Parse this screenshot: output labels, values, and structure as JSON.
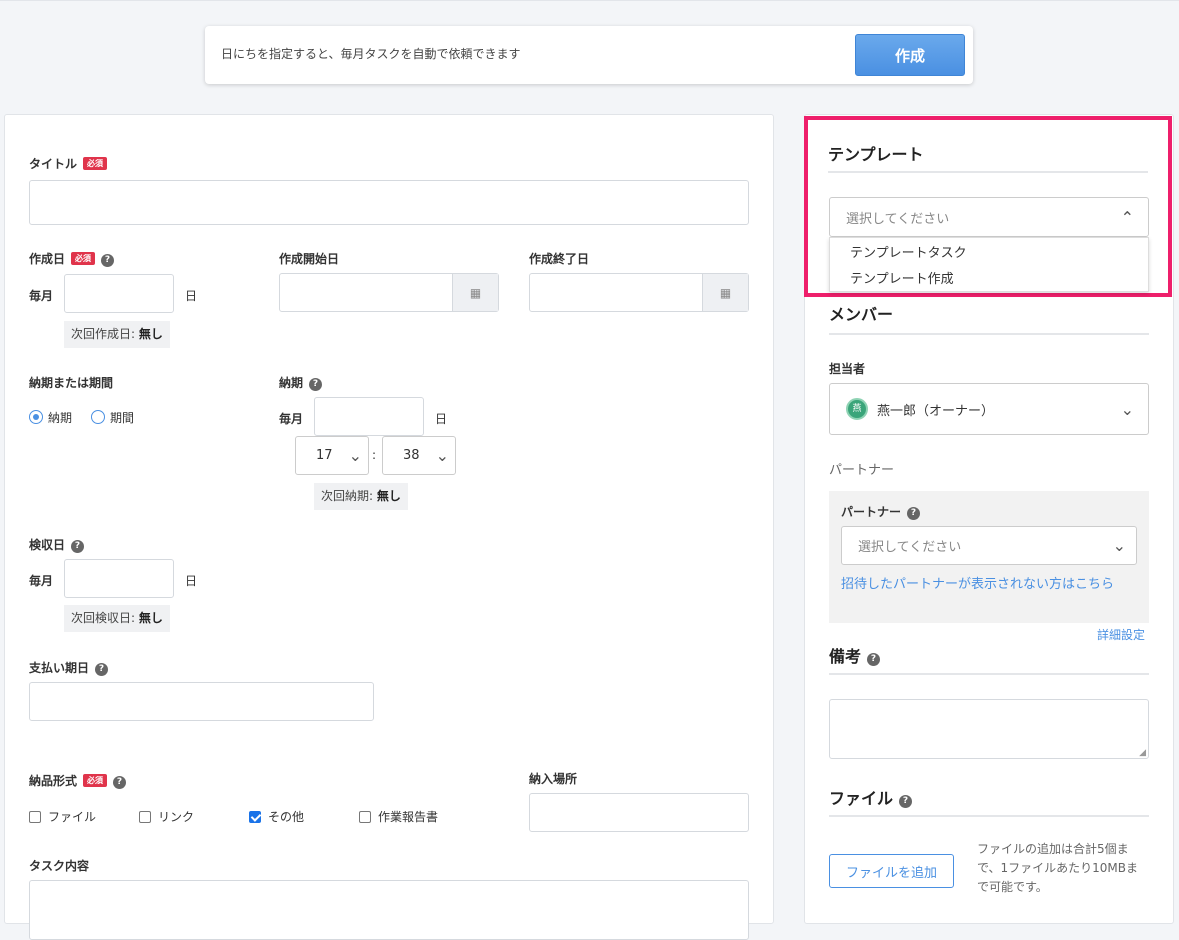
{
  "banner": {
    "text": "日にちを指定すると、毎月タスクを自動で依頼できます",
    "create_button": "作成"
  },
  "form": {
    "required_badge": "必須",
    "title_label": "タイトル",
    "title_value": "",
    "creation_day_label": "作成日",
    "monthly_label": "毎月",
    "day_suffix": "日",
    "next_creation_label": "次回作成日:",
    "next_creation_value": "無し",
    "creation_start_label": "作成開始日",
    "creation_end_label": "作成終了日",
    "deadline_or_period_label": "納期または期間",
    "radio_deadline": "納期",
    "radio_period": "期間",
    "deadline_label": "納期",
    "hour_value": "17",
    "time_separator": ":",
    "minute_value": "38",
    "next_deadline_label": "次回納期:",
    "next_deadline_value": "無し",
    "inspection_day_label": "検収日",
    "next_inspection_label": "次回検収日:",
    "next_inspection_value": "無し",
    "payment_due_label": "支払い期日",
    "delivery_format_label": "納品形式",
    "format_options": [
      {
        "label": "ファイル",
        "checked": false
      },
      {
        "label": "リンク",
        "checked": false
      },
      {
        "label": "その他",
        "checked": true
      },
      {
        "label": "作業報告書",
        "checked": false
      }
    ],
    "delivery_place_label": "納入場所",
    "task_content_label": "タスク内容"
  },
  "sidebar": {
    "template_title": "テンプレート",
    "template_placeholder": "選択してください",
    "template_options": [
      "テンプレートタスク",
      "テンプレート作成"
    ],
    "member_title": "メンバー",
    "assignee_label": "担当者",
    "assignee_avatar": "燕",
    "assignee_name": "燕一郎（オーナー）",
    "partner_heading": "パートナー",
    "partner_label": "パートナー",
    "partner_placeholder": "選択してください",
    "partner_link": "招待したパートナーが表示されない方はこちら",
    "detail_settings": "詳細設定",
    "notes_title": "備考",
    "file_title": "ファイル",
    "add_file_button": "ファイルを追加",
    "file_note": "ファイルの追加は合計5個まで、1ファイルあたり10MBまで可能です。"
  },
  "colors": {
    "accent": "#4a90e2",
    "required": "#e0344b",
    "highlight": "#ee1f6b",
    "avatar": "#3aa57a"
  }
}
